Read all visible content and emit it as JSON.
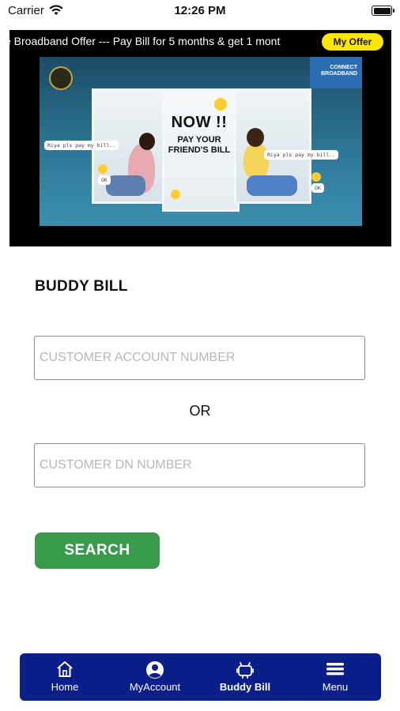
{
  "status_bar": {
    "carrier": "Carrier",
    "time": "12:26 PM"
  },
  "banner": {
    "ticker": "e Broadband Offer --- Pay Bill for 5 months & get 1 mont",
    "offer_button": "My Offer",
    "ad": {
      "headline": "NOW !!",
      "subline": "PAY YOUR FRIEND'S BILL",
      "chat_left": "Riya pls pay my bill..",
      "chat_right": "Riya pls pay my bill..",
      "ok_left": "OK",
      "ok_right": "OK",
      "brand": "CONNECT BROADBAND"
    }
  },
  "page": {
    "title": "BUDDY BILL",
    "account_placeholder": "CUSTOMER ACCOUNT NUMBER",
    "or_label": "OR",
    "dn_placeholder": "CUSTOMER DN NUMBER",
    "search_label": "SEARCH"
  },
  "nav": {
    "items": [
      {
        "label": "Home",
        "icon": "home-icon"
      },
      {
        "label": "MyAccount",
        "icon": "account-icon"
      },
      {
        "label": "Buddy Bill",
        "icon": "buddy-bill-icon",
        "active": true
      },
      {
        "label": "Menu",
        "icon": "menu-icon"
      }
    ]
  },
  "colors": {
    "nav_bg": "#0b1f8a",
    "search_bg": "#3a9a4b",
    "offer_bg": "#ffe600"
  }
}
